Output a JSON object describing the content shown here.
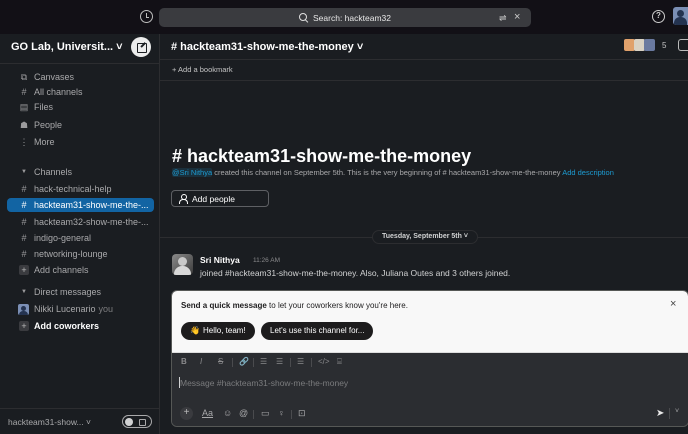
{
  "topbar": {
    "search_text": "Search: hackteam32",
    "filter_glyph": "⇌",
    "help_glyph": "?"
  },
  "sidebar": {
    "workspace_name": "GO Lab, Universit... ˅",
    "nav": [
      {
        "icon": "canvas-icon",
        "glyph": "⧉",
        "label": "Canvases"
      },
      {
        "icon": "hash-search-icon",
        "glyph": "#",
        "label": "All channels"
      },
      {
        "icon": "files-icon",
        "glyph": "▤",
        "label": "Files"
      },
      {
        "icon": "people-icon",
        "glyph": "☗",
        "label": "People"
      },
      {
        "icon": "more-icon",
        "glyph": "⋮",
        "label": "More"
      }
    ],
    "channels_header": "Channels",
    "channels": [
      {
        "label": "hack-technical-help",
        "selected": false
      },
      {
        "label": "hackteam31-show-me-the-...",
        "selected": true
      },
      {
        "label": "hackteam32-show-me-the-...",
        "selected": false
      },
      {
        "label": "indigo-general",
        "selected": false
      },
      {
        "label": "networking-lounge",
        "selected": false
      }
    ],
    "add_channels": "Add channels",
    "dm_header": "Direct messages",
    "dm_user": "Nikki Lucenario",
    "dm_you": "you",
    "add_coworkers": "Add coworkers",
    "footer_label": "hackteam31-show... ˅"
  },
  "channel": {
    "header_title": "# hackteam31-show-me-the-money ˅",
    "member_count": "5",
    "add_bookmark": "+ Add a bookmark",
    "intro_title": "# hackteam31-show-me-the-money",
    "intro_mention": "@Sri Nithya",
    "intro_desc": " created this channel on September 5th. This is the very beginning of # hackteam31-show-me-the-money ",
    "intro_link": "Add description",
    "add_people": "Add people",
    "day_divider": "Tuesday, September 5th ˅"
  },
  "message": {
    "author": "Sri Nithya",
    "time": "11:26 AM",
    "text": "joined #hackteam31-show-me-the-money. Also, Juliana Outes and 3 others joined."
  },
  "composer": {
    "prompt_bold": "Send a quick message",
    "prompt_rest": " to let your coworkers know you're here.",
    "chip1": "Hello, team!",
    "chip1_emoji": "👋",
    "chip2": "Let's use this channel for...",
    "placeholder": "Message #hackteam31-show-me-the-money",
    "format_tools": [
      "B",
      "I",
      "S",
      "🔗",
      "☰",
      "☰",
      "☰",
      "</>",
      "⌸"
    ],
    "actions": [
      "Aa",
      "☺",
      "@",
      "▭",
      "♀",
      "⊡"
    ]
  },
  "colors": {
    "accent": "#1264a3",
    "sidebar_bg": "#1a1d21",
    "link": "#1d9bd1"
  }
}
